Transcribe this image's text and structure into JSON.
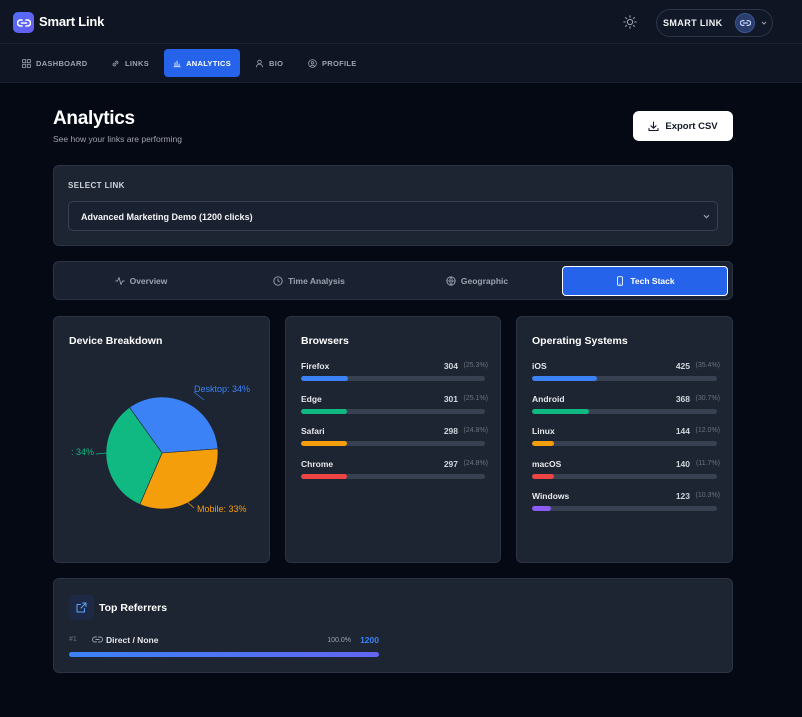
{
  "app": {
    "brand": "Smart Link"
  },
  "header": {
    "account_name": "SMART LINK"
  },
  "nav": {
    "items": [
      {
        "label": "DASHBOARD",
        "icon": "grid-icon",
        "active": false
      },
      {
        "label": "LINKS",
        "icon": "link-icon",
        "active": false
      },
      {
        "label": "ANALYTICS",
        "icon": "bar-chart-icon",
        "active": true
      },
      {
        "label": "BIO",
        "icon": "user-icon",
        "active": false
      },
      {
        "label": "PROFILE",
        "icon": "user-circle-icon",
        "active": false
      }
    ]
  },
  "page": {
    "title": "Analytics",
    "subtitle": "See how your links are performing",
    "export_label": "Export CSV"
  },
  "select": {
    "label": "SELECT LINK",
    "value": "Advanced Marketing Demo (1200 clicks)"
  },
  "tabs": [
    {
      "label": "Overview",
      "icon": "activity-icon",
      "active": false
    },
    {
      "label": "Time Analysis",
      "icon": "clock-icon",
      "active": false
    },
    {
      "label": "Geographic",
      "icon": "globe-icon",
      "active": false
    },
    {
      "label": "Tech Stack",
      "icon": "smartphone-icon",
      "active": true
    }
  ],
  "device": {
    "title": "Device Breakdown",
    "chart_data": {
      "type": "pie",
      "slices": [
        {
          "label": "Desktop: 34%",
          "value": 34,
          "color": "#3b82f6"
        },
        {
          "label": "Mobile: 33%",
          "value": 33,
          "color": "#f59e0b"
        },
        {
          "label": ": 34%",
          "value": 34,
          "color": "#10b981"
        }
      ]
    }
  },
  "browsers": {
    "title": "Browsers",
    "color_bar": "#3b82f6",
    "rows": [
      {
        "name": "Firefox",
        "count": "304",
        "pct": "(25.3%)",
        "fraction": 0.253,
        "color": "#3b82f6"
      },
      {
        "name": "Edge",
        "count": "301",
        "pct": "(25.1%)",
        "fraction": 0.251,
        "color": "#10b981"
      },
      {
        "name": "Safari",
        "count": "298",
        "pct": "(24.8%)",
        "fraction": 0.248,
        "color": "#f59e0b"
      },
      {
        "name": "Chrome",
        "count": "297",
        "pct": "(24.8%)",
        "fraction": 0.248,
        "color": "#ef4444"
      }
    ]
  },
  "os": {
    "title": "Operating Systems",
    "rows": [
      {
        "name": "iOS",
        "count": "425",
        "pct": "(35.4%)",
        "fraction": 0.354,
        "color": "#3b82f6"
      },
      {
        "name": "Android",
        "count": "368",
        "pct": "(30.7%)",
        "fraction": 0.307,
        "color": "#10b981"
      },
      {
        "name": "Linux",
        "count": "144",
        "pct": "(12.0%)",
        "fraction": 0.12,
        "color": "#f59e0b"
      },
      {
        "name": "macOS",
        "count": "140",
        "pct": "(11.7%)",
        "fraction": 0.117,
        "color": "#ef4444"
      },
      {
        "name": "Windows",
        "count": "123",
        "pct": "(10.3%)",
        "fraction": 0.103,
        "color": "#8b5cf6"
      }
    ]
  },
  "referrers": {
    "title": "Top Referrers",
    "rows": [
      {
        "rank": "#1",
        "name": "Direct / None",
        "pct": "100.0%",
        "count": "1200",
        "fraction": 1.0
      }
    ]
  }
}
